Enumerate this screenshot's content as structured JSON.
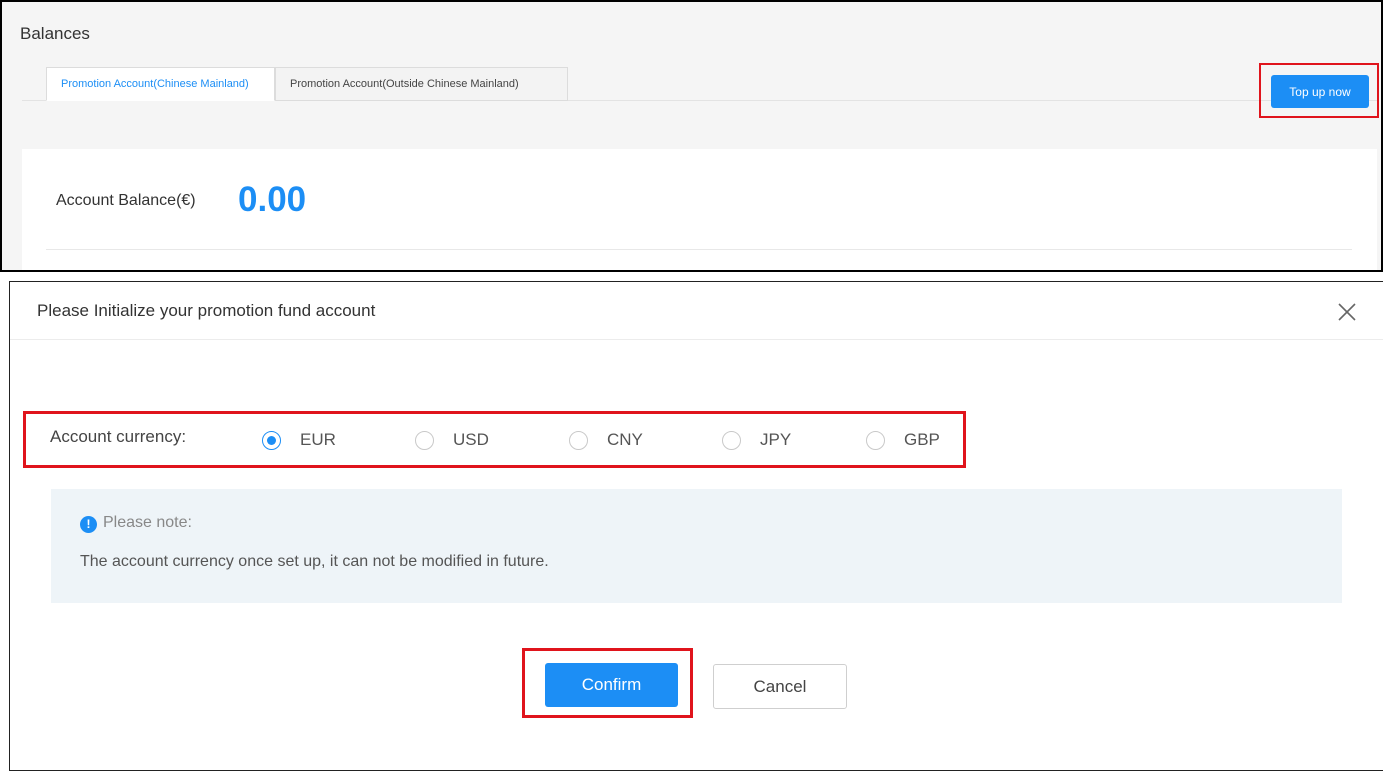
{
  "balances": {
    "title": "Balances",
    "tabs": [
      {
        "label": "Promotion Account(Chinese Mainland)",
        "active": true
      },
      {
        "label": "Promotion Account(Outside Chinese Mainland)",
        "active": false
      }
    ],
    "topup_label": "Top up now",
    "balance_label": "Account Balance(€)",
    "balance_value": "0.00"
  },
  "dialog": {
    "title": "Please Initialize your promotion fund account",
    "close_icon": "close-icon",
    "currency_label": "Account currency:",
    "currencies": [
      {
        "label": "EUR",
        "selected": true
      },
      {
        "label": "USD",
        "selected": false
      },
      {
        "label": "CNY",
        "selected": false
      },
      {
        "label": "JPY",
        "selected": false
      },
      {
        "label": "GBP",
        "selected": false
      }
    ],
    "note_head": "Please note:",
    "note_icon": "!",
    "note_text": "The account currency once set up, it can not be modified in future.",
    "confirm_label": "Confirm",
    "cancel_label": "Cancel"
  },
  "colors": {
    "accent": "#1c8ef5",
    "highlight": "#e0141c"
  }
}
